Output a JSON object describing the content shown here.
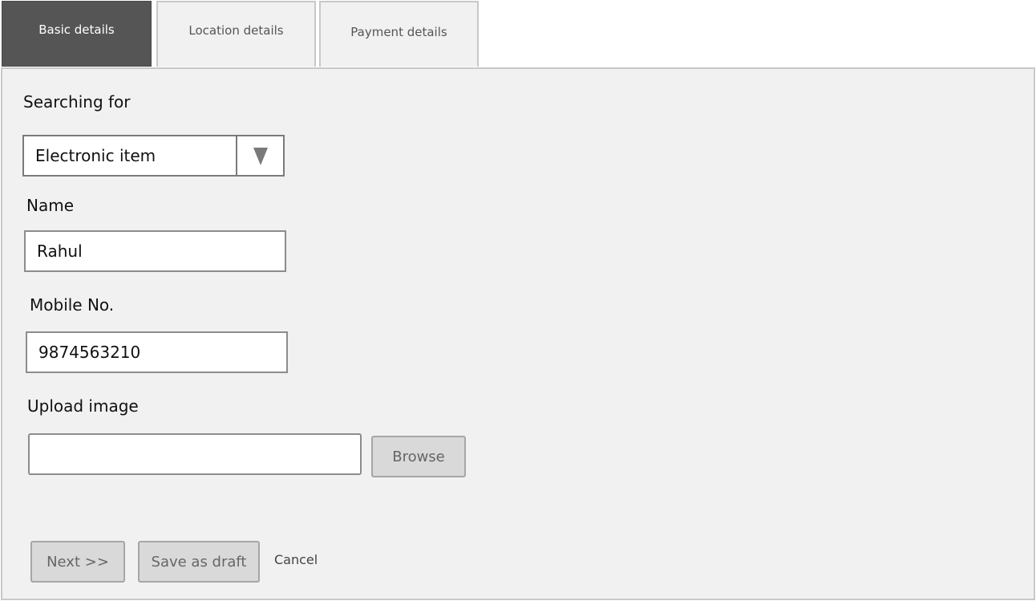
{
  "tabs": [
    {
      "label": "Basic details",
      "active": true
    },
    {
      "label": "Location details",
      "active": false
    },
    {
      "label": "Payment details",
      "active": false
    }
  ],
  "form": {
    "searching_for": {
      "label": "Searching for",
      "value": "Electronic item",
      "icon": "triangle-down-icon"
    },
    "name": {
      "label": "Name",
      "value": "Rahul"
    },
    "mobile": {
      "label": "Mobile No.",
      "value": "9874563210"
    },
    "upload": {
      "label": "Upload image",
      "value": "",
      "browse_label": "Browse"
    }
  },
  "actions": {
    "next_label": "Next >>",
    "save_draft_label": "Save as draft",
    "cancel_label": "Cancel"
  },
  "colors": {
    "active_tab": "#555555",
    "panel_bg": "#f1f1f1",
    "button_bg": "#d9d9d9"
  }
}
